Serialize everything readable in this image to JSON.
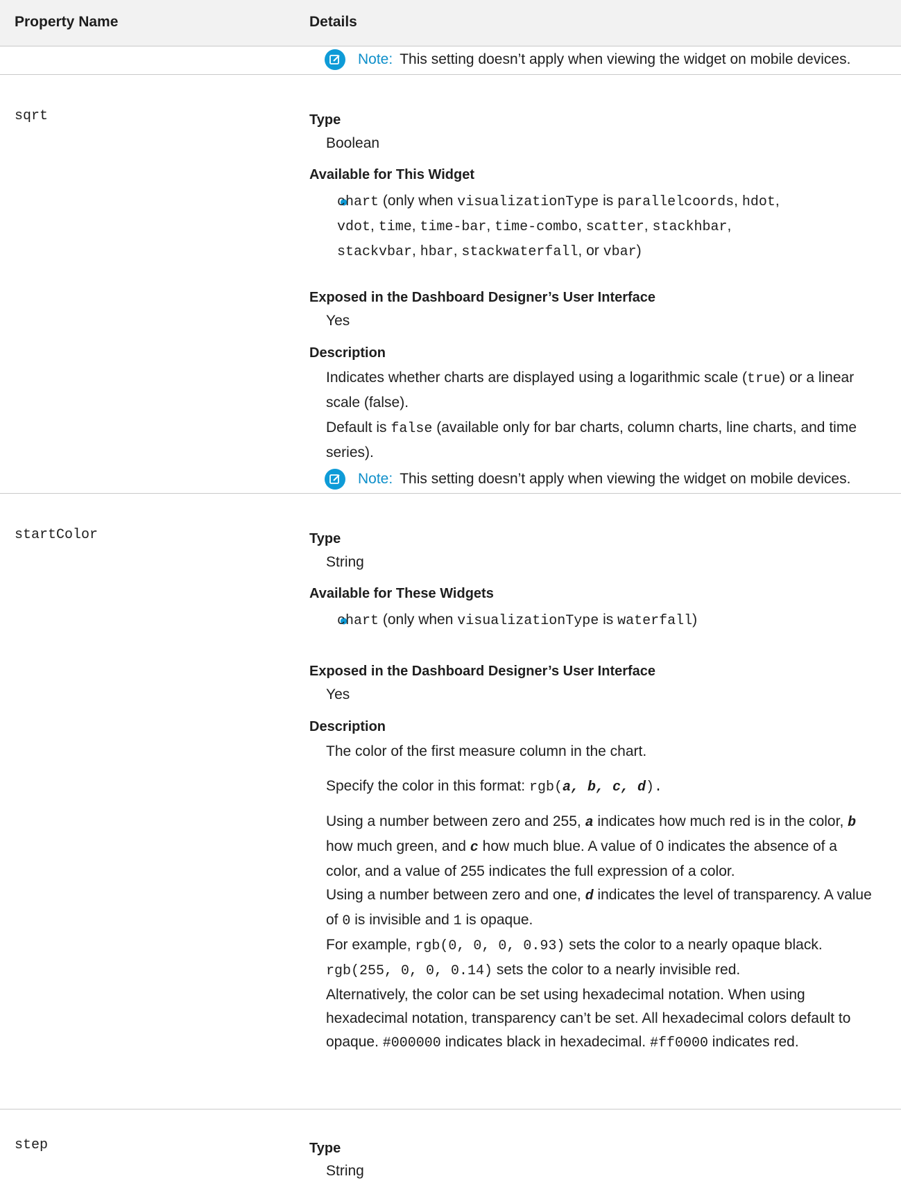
{
  "header": {
    "col1": "Property Name",
    "col2": "Details"
  },
  "top_note": {
    "label": "Note:",
    "text": "This setting doesn’t apply when viewing the widget on mobile devices."
  },
  "sqrt": {
    "name": "sqrt",
    "type_label": "Type",
    "type_value": "Boolean",
    "avail_label": "Available for This Widget",
    "avail_parts": [
      "chart",
      " (only when ",
      "visualizationType",
      " is ",
      "parallelcoords",
      ", ",
      "hdot",
      ","
    ],
    "avail_line2": [
      "vdot",
      ", ",
      "time",
      ", ",
      "time-bar",
      ", ",
      "time-combo",
      ", ",
      "scatter",
      ", ",
      "stackhbar",
      ","
    ],
    "avail_line3": [
      "stackvbar",
      ", ",
      "hbar",
      ", ",
      "stackwaterfall",
      ", or ",
      "vbar",
      ")"
    ],
    "exposed_label": "Exposed in the Dashboard Designer’s User Interface",
    "exposed_value": "Yes",
    "desc_label": "Description",
    "desc1a": "Indicates whether charts are displayed using a logarithmic scale (",
    "desc1b": "true",
    "desc1c": ") or a linear",
    "desc1d": "scale (false).",
    "desc2a": "Default is ",
    "desc2b": "false",
    "desc2c": " (available only for bar charts, column charts, line charts, and time",
    "desc2d": "series).",
    "note_label": "Note:",
    "note_text": "This setting doesn’t apply when viewing the widget on mobile devices."
  },
  "startColor": {
    "name": "startColor",
    "type_label": "Type",
    "type_value": "String",
    "avail_label": "Available for These Widgets",
    "avail": [
      "chart",
      " (only when ",
      "visualizationType",
      " is ",
      "waterfall",
      ")"
    ],
    "exposed_label": "Exposed in the Dashboard Designer’s User Interface",
    "exposed_value": "Yes",
    "desc_label": "Description",
    "p1": "The color of the first measure column in the chart.",
    "p2a": "Specify the color in this format: ",
    "p2b": "rgb(",
    "p2c": "a, b, c, d",
    "p2d": ").",
    "p3l1a": "Using a number between zero and 255, ",
    "p3l1b": "a",
    "p3l1c": " indicates how much red is in the color, ",
    "p3l1d": "b",
    "p3l2a": "how much green, and ",
    "p3l2b": "c",
    "p3l2c": " how much blue. A value of 0 indicates the absence of a",
    "p3l3": "color, and a value of 255 indicates the full expression of a color.",
    "p4l1a": "Using a number between zero and one, ",
    "p4l1b": "d",
    "p4l1c": " indicates the level of transparency. A value",
    "p4l2a": "of ",
    "p4l2b": "0",
    "p4l2c": " is invisible and ",
    "p4l2d": "1",
    "p4l2e": " is opaque.",
    "p5l1a": "For example, ",
    "p5l1b": "rgb(0, 0, 0, 0.93)",
    "p5l1c": " sets the color to a nearly opaque black.",
    "p5l2a": "rgb(255, 0, 0, 0.14)",
    "p5l2b": " sets the color to a nearly invisible red.",
    "p6l1": "Alternatively, the color can be set using hexadecimal notation. When using",
    "p6l2": "hexadecimal notation, transparency can’t be set. All hexadecimal colors default to",
    "p6l3a": "opaque. ",
    "p6l3b": "#000000",
    "p6l3c": " indicates black in hexadecimal. ",
    "p6l3d": "#ff0000",
    "p6l3e": " indicates red."
  },
  "step": {
    "name": "step",
    "type_label": "Type",
    "type_value": "String"
  },
  "colors": {
    "accent": "#0e9bd7",
    "header_bg": "#f2f2f2",
    "rule": "#c9c9c9"
  }
}
